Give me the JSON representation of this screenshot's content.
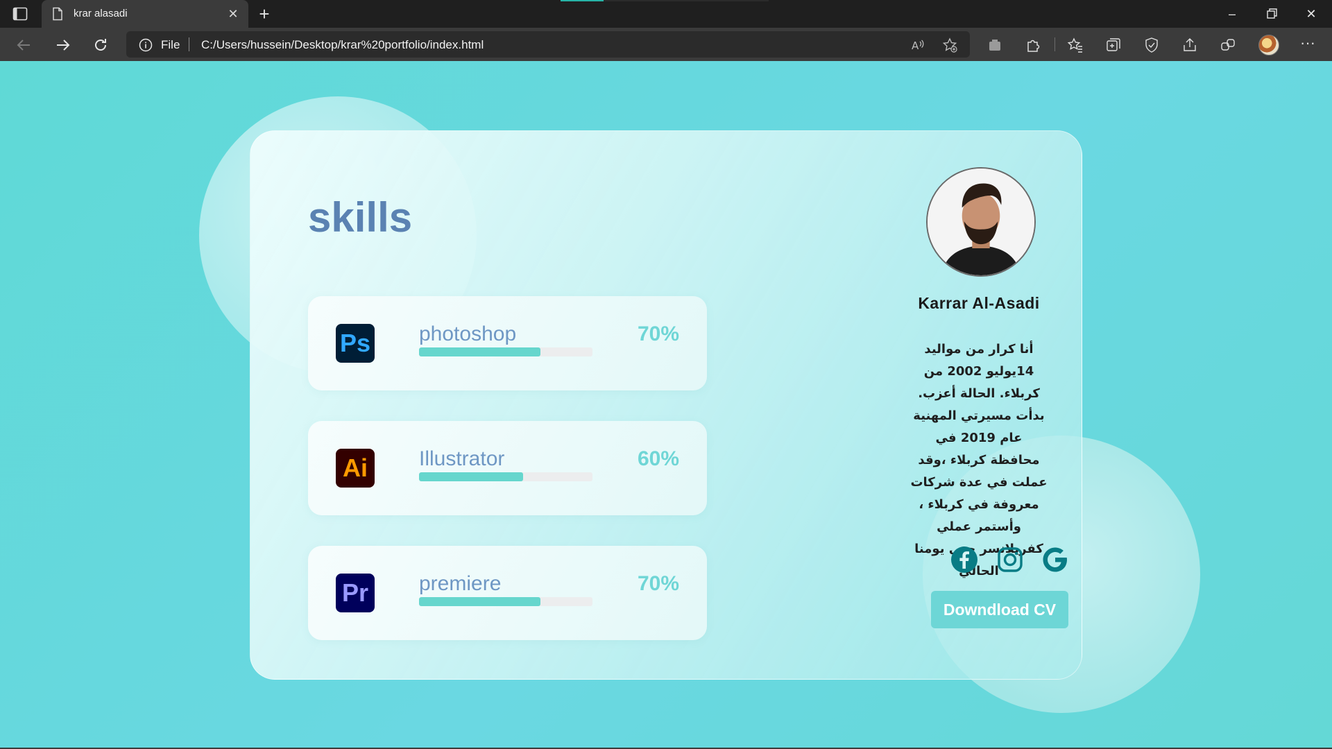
{
  "browser": {
    "tab_title": "krar alasadi",
    "address_scheme": "File",
    "url": "C:/Users/hussein/Desktop/krar%20portfolio/index.html",
    "icons": [
      "tab-actions-icon",
      "document-icon",
      "close-icon",
      "plus-icon",
      "minimize-icon",
      "restore-icon",
      "window-close-icon",
      "back-icon",
      "forward-icon",
      "refresh-icon",
      "info-icon",
      "read-aloud-icon",
      "add-favorite-icon",
      "extension-puzzle-icon",
      "favorites-icon",
      "collections-icon",
      "browser-essentials-icon",
      "share-icon",
      "copilot-icon",
      "more-icon"
    ]
  },
  "page": {
    "skills_title": "skills",
    "skills": [
      {
        "icon_text": "Ps",
        "name": "photoshop",
        "percent_label": "70%",
        "level": 0.7
      },
      {
        "icon_text": "Ai",
        "name": "Illustrator",
        "percent_label": "60%",
        "level": 0.6
      },
      {
        "icon_text": "Pr",
        "name": "premiere",
        "percent_label": "70%",
        "level": 0.7
      }
    ],
    "profile": {
      "name": "Karrar Al-Asadi",
      "bio": "أنا كرار من مواليد 14يوليو 2002 من كربلاء. الحالة أعزب. بدأت مسيرتي المهنية عام 2019 في محافظة كربلاء ،وقد عملت في عدة شركات معروفة في كربلاء ، وأستمر عملي كفريلانسر حتى يومنا الحالي",
      "socials": [
        "facebook-icon",
        "instagram-icon",
        "google-icon"
      ],
      "cv_button": "Downdload CV"
    }
  },
  "colors": {
    "background": "#64d8d8",
    "title": "#5a82b2",
    "accent": "#6dd6d6",
    "social": "#087c85"
  }
}
